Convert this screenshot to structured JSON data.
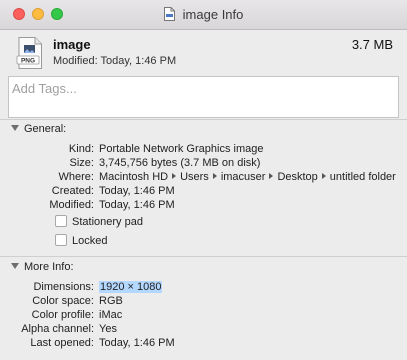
{
  "window": {
    "title": "image Info"
  },
  "header": {
    "name": "image",
    "size": "3.7 MB",
    "modified": "Modified: Today, 1:46 PM",
    "icon_badge": "PNG"
  },
  "tags": {
    "placeholder": "Add Tags..."
  },
  "general": {
    "heading": "General:",
    "rows": [
      {
        "label": "Kind:",
        "value": "Portable Network Graphics image"
      },
      {
        "label": "Size:",
        "value": "3,745,756 bytes (3.7 MB on disk)"
      },
      {
        "label": "Where:",
        "path": [
          "Macintosh HD",
          "Users",
          "imacuser",
          "Desktop",
          "untitled folder"
        ]
      },
      {
        "label": "Created:",
        "value": "Today, 1:46 PM"
      },
      {
        "label": "Modified:",
        "value": "Today, 1:46 PM"
      }
    ],
    "checkboxes": [
      {
        "label": "Stationery pad",
        "checked": false
      },
      {
        "label": "Locked",
        "checked": false
      }
    ]
  },
  "more_info": {
    "heading": "More Info:",
    "rows": [
      {
        "label": "Dimensions:",
        "value": "1920 × 1080"
      },
      {
        "label": "Color space:",
        "value": "RGB"
      },
      {
        "label": "Color profile:",
        "value": "iMac"
      },
      {
        "label": "Alpha channel:",
        "value": "Yes"
      },
      {
        "label": "Last opened:",
        "value": "Today, 1:46 PM"
      }
    ]
  }
}
